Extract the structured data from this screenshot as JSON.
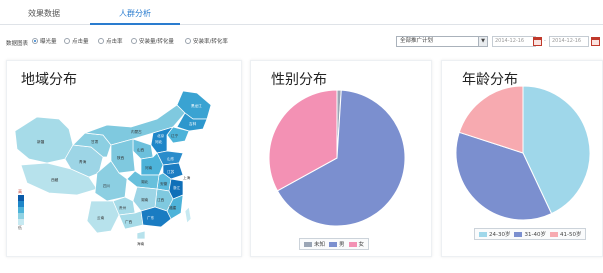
{
  "tabs": [
    {
      "label": "效果数据",
      "active": false
    },
    {
      "label": "人群分析",
      "active": true
    }
  ],
  "filters": {
    "label": "数据图表",
    "options": [
      {
        "label": "曝光量",
        "selected": true
      },
      {
        "label": "点击量",
        "selected": false
      },
      {
        "label": "点击率",
        "selected": false
      },
      {
        "label": "安装量/转化量",
        "selected": false
      },
      {
        "label": "安装率/转化率",
        "selected": false
      }
    ],
    "plan_select": "全部推广计划",
    "date_start": "2014-12-16",
    "date_sep": "-",
    "date_end": "2014-12-16"
  },
  "panels": {
    "region": {
      "title": "地域分布",
      "scale_high": "高",
      "scale_low": "低",
      "scale_colors": [
        "#0a5aa8",
        "#1f86c8",
        "#4db3d9",
        "#8fd2e3",
        "#c7e9f1"
      ],
      "provinces": [
        "新疆",
        "西藏",
        "青海",
        "甘肃",
        "内蒙古",
        "四川",
        "云南",
        "广西",
        "广东",
        "福建",
        "浙江",
        "江苏",
        "山东",
        "河北",
        "北京",
        "辽宁",
        "吉林",
        "黑龙江",
        "湖南",
        "江西",
        "湖北",
        "河南",
        "陕西",
        "山西",
        "贵州",
        "安徽",
        "上海",
        "海南"
      ]
    },
    "gender": {
      "title": "性别分布",
      "legend": [
        "未知",
        "男",
        "女"
      ]
    },
    "age": {
      "title": "年龄分布",
      "legend": [
        "24-30岁",
        "31-40岁",
        "41-50岁"
      ]
    }
  },
  "colors": {
    "accent": "#2a7ccf",
    "gender_unknown": "#9aa5b5",
    "gender_male": "#7b8fcf",
    "gender_female": "#f391b4",
    "age_24_30": "#9fd7ea",
    "age_31_40": "#7b8fcf",
    "age_41_50": "#f7aab0"
  },
  "chart_data": [
    {
      "type": "pie",
      "title": "性别分布",
      "labels": [
        "未知",
        "男",
        "女"
      ],
      "values": [
        1,
        66,
        33
      ]
    },
    {
      "type": "pie",
      "title": "年龄分布",
      "labels": [
        "24-30岁",
        "31-40岁",
        "41-50岁"
      ],
      "values": [
        43,
        37,
        20
      ]
    }
  ]
}
